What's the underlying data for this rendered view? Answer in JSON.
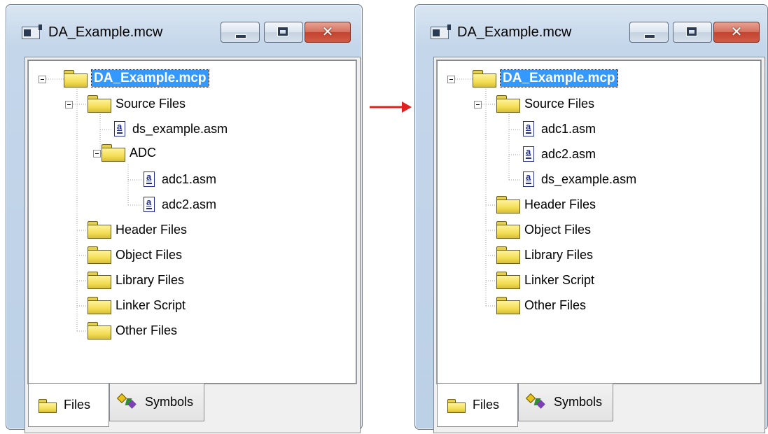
{
  "colors": {
    "selection": "#3399ff",
    "arrow": "#e02020",
    "folder": "#f3de55"
  },
  "left": {
    "title": "DA_Example.mcw",
    "project": "DA_Example.mcp",
    "source_folder": "Source Files",
    "source_file": "ds_example.asm",
    "sub_folder": "ADC",
    "sub_files": [
      "adc1.asm",
      "adc2.asm"
    ],
    "folders": [
      "Header Files",
      "Object Files",
      "Library Files",
      "Linker Script",
      "Other Files"
    ],
    "tabs": {
      "files": "Files",
      "symbols": "Symbols"
    }
  },
  "right": {
    "title": "DA_Example.mcw",
    "project": "DA_Example.mcp",
    "source_folder": "Source Files",
    "source_files": [
      "adc1.asm",
      "adc2.asm",
      "ds_example.asm"
    ],
    "folders": [
      "Header Files",
      "Object Files",
      "Library Files",
      "Linker Script",
      "Other Files"
    ],
    "tabs": {
      "files": "Files",
      "symbols": "Symbols"
    }
  },
  "icons": {
    "app": "workspace-icon",
    "folder": "folder-icon",
    "file": "asm-file-icon",
    "symbols": "symbols-icon",
    "transition": "arrow-right-icon"
  }
}
